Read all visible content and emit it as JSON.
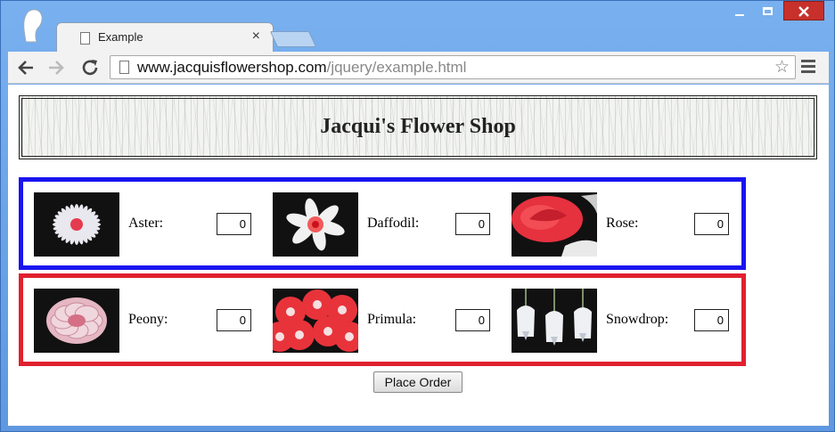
{
  "browser": {
    "tab_title": "Example",
    "tab_close": "×",
    "url_host": "www.jacquisflowershop.com",
    "url_path": "/jquery/example.html",
    "icons": {
      "back": "arrow-left-icon",
      "forward": "arrow-right-icon",
      "reload": "reload-icon",
      "star": "star-icon",
      "menu": "hamburger-menu-icon"
    }
  },
  "page": {
    "title": "Jacqui's Flower Shop",
    "order_button": "Place Order",
    "colors": {
      "row1_border": "#1a14f0",
      "row2_border": "#e0202f"
    },
    "rows": [
      [
        {
          "name": "Aster:",
          "qty": "0",
          "flower": "aster"
        },
        {
          "name": "Daffodil:",
          "qty": "0",
          "flower": "daffodil"
        },
        {
          "name": "Rose:",
          "qty": "0",
          "flower": "rose"
        }
      ],
      [
        {
          "name": "Peony:",
          "qty": "0",
          "flower": "peony"
        },
        {
          "name": "Primula:",
          "qty": "0",
          "flower": "primula"
        },
        {
          "name": "Snowdrop:",
          "qty": "0",
          "flower": "snowdrop"
        }
      ]
    ]
  }
}
